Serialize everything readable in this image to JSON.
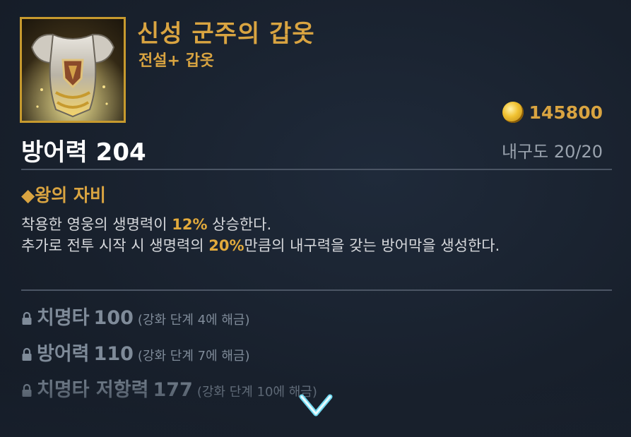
{
  "item": {
    "name": "신성 군주의 갑옷",
    "type": "전설+ 갑옷",
    "price": "145800",
    "defense": "방어력 204",
    "durability": "내구도 20/20"
  },
  "skill": {
    "title": "◆왕의 자비",
    "line1_a": "착용한 영웅의 생명력이 ",
    "line1_hl": "12%",
    "line1_b": " 상승한다.",
    "line2_a": "추가로 전투 시작 시 생명력의 ",
    "line2_hl": "20%",
    "line2_b": "만큼의 내구력을 갖는 방어막을 생성한다."
  },
  "locked_stats": [
    {
      "name": "치명타",
      "value": "100",
      "note": "(강화 단계 4에 해금)"
    },
    {
      "name": "방어력",
      "value": "110",
      "note": "(강화 단계 7에 해금)"
    },
    {
      "name": "치명타 저항력",
      "value": "177",
      "note": "(강화 단계 10에 해금)"
    }
  ],
  "icons": {
    "item": "armor-icon",
    "currency": "gold-coin-icon",
    "lock": "lock-icon",
    "scroll": "chevron-down-icon"
  },
  "colors": {
    "accent_gold": "#d9a441",
    "highlight": "#e2aa3c",
    "locked_text": "#7f8b99",
    "background": "#1a2230"
  }
}
